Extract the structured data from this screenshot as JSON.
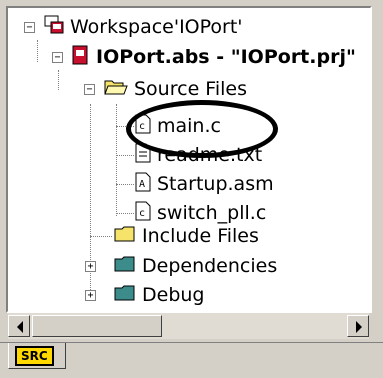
{
  "tree": {
    "workspace": "Workspace'IOPort'",
    "project": "IOPort.abs - \"IOPort.prj\"",
    "folders": {
      "source": "Source Files",
      "include": "Include Files",
      "dependencies": "Dependencies",
      "debug": "Debug"
    },
    "files": [
      "main.c",
      "readme.txt",
      "Startup.asm",
      "switch_pll.c"
    ],
    "toggles": {
      "collapse": "−",
      "expand": "+"
    }
  },
  "tabs": {
    "src": "SRC"
  },
  "colors": {
    "folder_yellow": "#f6e36a",
    "folder_teal": "#3c8c8c",
    "project_red": "#c8102e",
    "tab_yellow": "#ffd800"
  }
}
